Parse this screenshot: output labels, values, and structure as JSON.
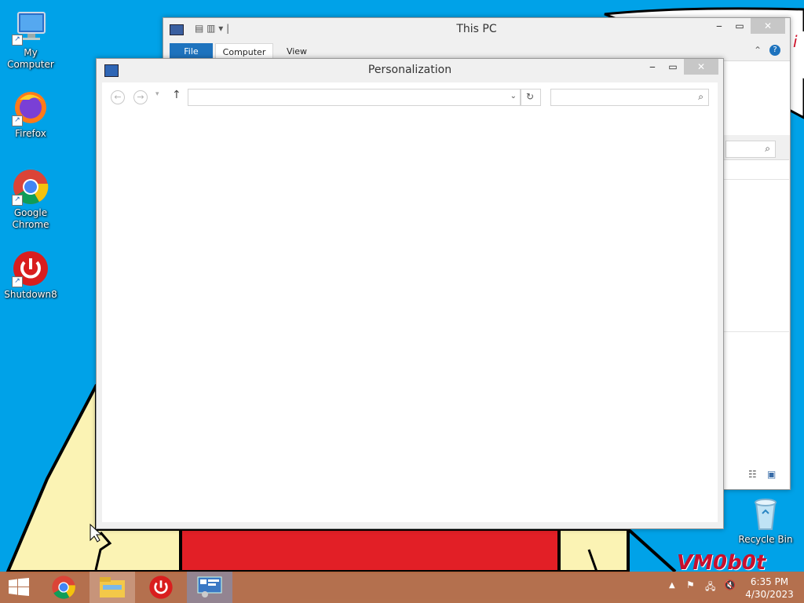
{
  "desktop": {
    "icons": [
      {
        "label": "My Computer",
        "icon": "computer-icon"
      },
      {
        "label": "Firefox",
        "icon": "firefox-icon"
      },
      {
        "label": "Google Chrome",
        "icon": "chrome-icon"
      },
      {
        "label": "Shutdown8",
        "icon": "power-icon"
      },
      {
        "label": "Recycle Bin",
        "icon": "recycle-bin-icon"
      }
    ],
    "watermark": "VM0b0t"
  },
  "this_pc": {
    "title": "This PC",
    "tabs": [
      "File",
      "Computer",
      "View"
    ],
    "accent": "#1e73be"
  },
  "personalization": {
    "title": "Personalization",
    "address_value": "",
    "search_value": ""
  },
  "taskbar": {
    "time": "6:35 PM",
    "date": "4/30/2023",
    "items": [
      "start-icon",
      "chrome-icon",
      "file-explorer-icon",
      "shutdown8-icon",
      "control-panel-icon"
    ],
    "color": "#be6e46"
  }
}
